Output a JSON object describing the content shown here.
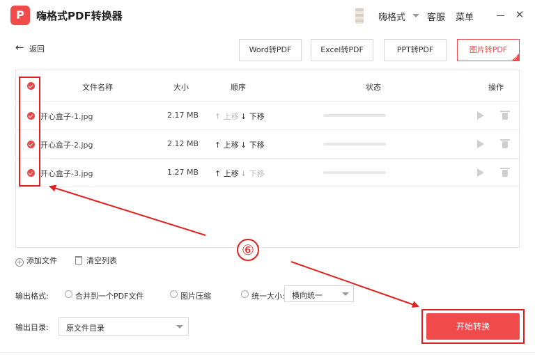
{
  "app": {
    "logo_letter": "P",
    "title": "嗨格式PDF转换器",
    "user_name": "嗨格式",
    "service": "客服",
    "menu": "菜单",
    "close_glyph": "✕"
  },
  "toolbar": {
    "back_arrow": "←",
    "back_label": "返回",
    "tabs": [
      {
        "label": "Word转PDF"
      },
      {
        "label": "Excel转PDF"
      },
      {
        "label": "PPT转PDF"
      },
      {
        "label": "图片转PDF",
        "active": true
      }
    ]
  },
  "table": {
    "headers": {
      "name": "文件名称",
      "size": "大小",
      "order": "顺序",
      "status": "状态",
      "action": "操作"
    },
    "rows": [
      {
        "name": "开心盒子-1.jpg",
        "size": "2.17 MB",
        "up": "↑ 上移",
        "down": "↓ 下移",
        "up_enabled": false,
        "down_enabled": true,
        "progress": 0
      },
      {
        "name": "开心盒子-2.jpg",
        "size": "2.12 MB",
        "up": "↑ 上移",
        "down": "↓ 下移",
        "up_enabled": true,
        "down_enabled": true,
        "progress": 0
      },
      {
        "name": "开心盒子-3.jpg",
        "size": "1.27 MB",
        "up": "↑ 上移",
        "down": "↓ 下移",
        "up_enabled": true,
        "down_enabled": false,
        "progress": 0
      }
    ]
  },
  "actions": {
    "add_file": "添加文件",
    "add_glyph": "+",
    "clear_list": "清空列表"
  },
  "output": {
    "format_label": "输出格式:",
    "merge_option": "合并到一个PDF文件",
    "compress_option": "图片压缩",
    "uniform_size_option": "统一大小:",
    "uniform_size_value": "横向统一",
    "dir_label": "输出目录:",
    "dir_value": "原文件目录"
  },
  "start_button": "开始转换",
  "annotation": {
    "step_number": "⑥",
    "color": "#e0201c"
  },
  "colors": {
    "accent": "#f04a4a"
  }
}
